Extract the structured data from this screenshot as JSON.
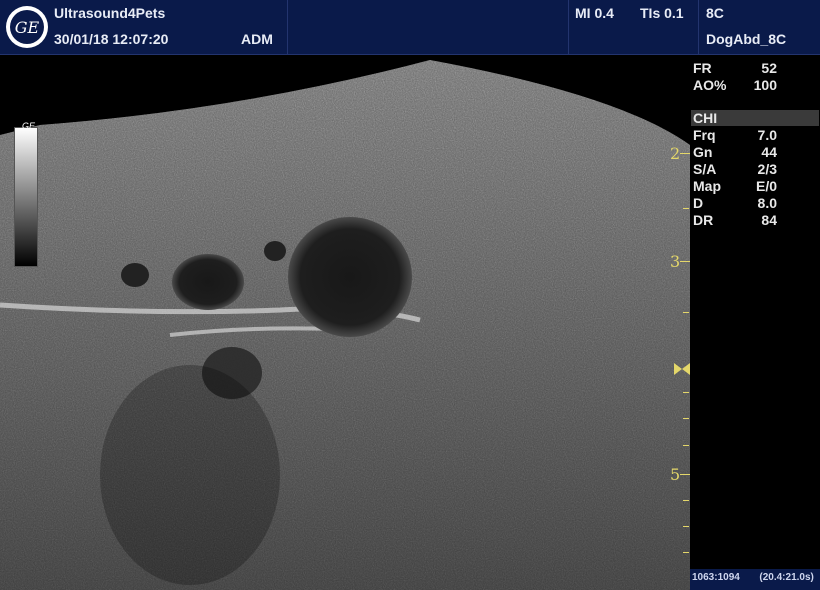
{
  "header": {
    "brand": "Ultrasound4Pets",
    "datetime": "30/01/18 12:07:20",
    "operator": "ADM",
    "mi": "MI 0.4",
    "tis": "TIs 0.1",
    "probe": "8C",
    "preset": "DogAbd_8C"
  },
  "logo": {
    "text": "GE"
  },
  "params": [
    {
      "label": "FR",
      "value": "52"
    },
    {
      "label": "AO%",
      "value": "100"
    }
  ],
  "chi_header": "CHI",
  "chi_params": [
    {
      "label": "Frq",
      "value": "7.0"
    },
    {
      "label": "Gn",
      "value": "44"
    },
    {
      "label": "S/A",
      "value": "2/3"
    },
    {
      "label": "Map",
      "value": "E/0"
    },
    {
      "label": "D",
      "value": "8.0"
    },
    {
      "label": "DR",
      "value": "84"
    }
  ],
  "depth_labels": [
    "2",
    "3",
    "5"
  ],
  "grayscale_label": "GE",
  "footer": {
    "frames": "1063:1094",
    "time": "(20.4:21.0s)"
  },
  "colors": {
    "header_bg": "#0a1a4a",
    "depth_marker": "#e4d76a"
  }
}
